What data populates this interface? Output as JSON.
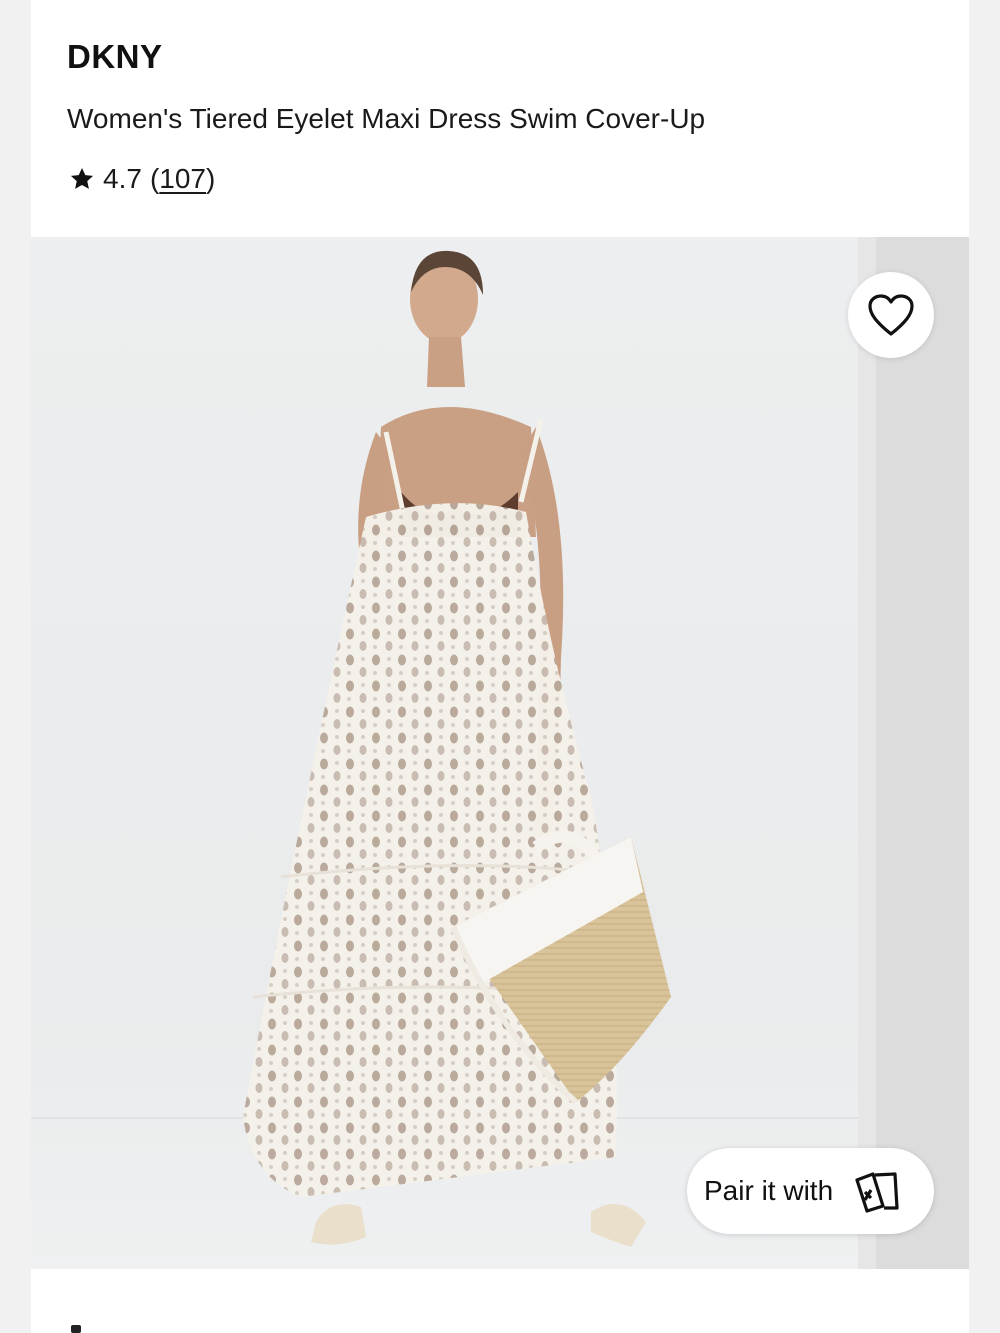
{
  "product": {
    "brand": "DKNY",
    "title": "Women's Tiered Eyelet Maxi Dress Swim Cover-Up",
    "rating": "4.7",
    "review_count": "107"
  },
  "gallery": {
    "pair_label": "Pair it with",
    "favorite_icon": "heart-icon",
    "pair_icon": "cards-icon"
  },
  "colors": {
    "text": "#1a1a1a",
    "background": "#ffffff",
    "page_bg": "#f1f1f1"
  }
}
